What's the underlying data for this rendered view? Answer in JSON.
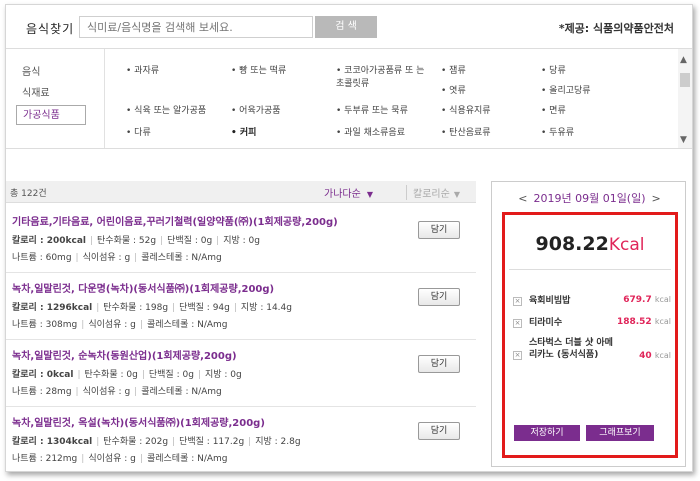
{
  "search": {
    "title": "음식찾기",
    "placeholder": "식미료/음식명을 검색해 보세요.",
    "button_label": "검 색",
    "source": "*제공: 식품의약품안전처"
  },
  "category_nav": [
    {
      "label": "음식",
      "active": false
    },
    {
      "label": "식재료",
      "active": false
    },
    {
      "label": "가공식품",
      "active": true
    }
  ],
  "categories": {
    "c1": "• 과자류",
    "c2": "• 빵 또는 떡류",
    "c3": "• 코코아가공품류 또 는 초콜릿류",
    "c4": "• 잼류",
    "c5": "• 당류",
    "c6": "• 엿류",
    "c7": "• 올리고당류",
    "c8": "• 식육 또는 알가공품",
    "c9": "• 어육가공품",
    "c10": "• 두부류 또는 묵류",
    "c11": "• 식용유지류",
    "c12": "• 면류",
    "c13": "• 다류",
    "c14": "• 커피",
    "c15": "• 과일 채소류음료",
    "c16": "• 탄산음료류",
    "c17": "• 두유류"
  },
  "results": {
    "total": "총 122건",
    "sort_primary": "가나다순",
    "sort_secondary": "칼로리순"
  },
  "foods": [
    {
      "name": "기타음료,기타음료, 어린이음료,꾸러기철력(일양약품(㈜)(1회제공량,200g)",
      "calorie": "칼로리 : 200kcal",
      "carb": "탄수화물 : 52g",
      "protein": "단백질 : 0g",
      "fat": "지방 : 0g",
      "sodium": "나트륨 : 60mg",
      "fiber": "식이섬유 : g",
      "chol": "콜레스테롤 : N/Amg",
      "button": "담기"
    },
    {
      "name": "녹차,일말린것, 다운명(녹차)(동서식품㈜)(1회제공량,200g)",
      "calorie": "칼로리 : 1296kcal",
      "carb": "탄수화물 : 198g",
      "protein": "단백질 : 94g",
      "fat": "지방 : 14.4g",
      "sodium": "나트륨 : 308mg",
      "fiber": "식이섬유 : g",
      "chol": "콜레스테롤 : N/Amg",
      "button": "담기"
    },
    {
      "name": "녹차,일말린것, 순녹차(동원산업)(1회제공량,200g)",
      "calorie": "칼로리 : 0kcal",
      "carb": "탄수화물 : 0g",
      "protein": "단백질 : 0g",
      "fat": "지방 : 0g",
      "sodium": "나트륨 : 28mg",
      "fiber": "식이섬유 : g",
      "chol": "콜레스테롤 : N/Amg",
      "button": "담기"
    },
    {
      "name": "녹차,일말린것, 옥설(녹차)(동서식품㈜)(1회제공량,200g)",
      "calorie": "칼로리 : 1304kcal",
      "carb": "탄수화물 : 202g",
      "protein": "단백질 : 117.2g",
      "fat": "지방 : 2.8g",
      "sodium": "나트륨 : 212mg",
      "fiber": "식이섬유 : g",
      "chol": "콜레스테롤 : N/Amg",
      "button": "담기"
    }
  ],
  "diary": {
    "prev": "<",
    "next": ">",
    "date": "2019년 09월 01일(일)",
    "total_value": "908.22",
    "total_unit": "Kcal",
    "items": [
      {
        "name": "육회비빔밥",
        "kcal": "679.7",
        "unit": "kcal"
      },
      {
        "name": "티라미수",
        "kcal": "188.52",
        "unit": "kcal"
      },
      {
        "name": "스타벅스 더블 샷 아메리카노 (동서식품)",
        "kcal": "40",
        "unit": "kcal"
      }
    ],
    "remove_symbol": "×",
    "save_label": "저장하기",
    "graph_label": "그래프보기"
  },
  "colors": {
    "accent": "#7b2d8e",
    "highlight_border": "#e21a1a",
    "kcal": "#e0265a"
  }
}
